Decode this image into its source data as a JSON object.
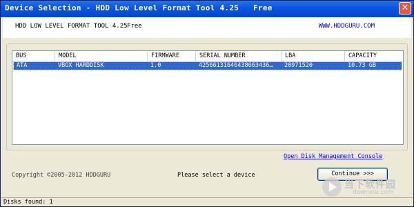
{
  "window": {
    "title": "Device Selection - HDD Low Level Format Tool 4.25   Free",
    "close_glyph": "✕"
  },
  "header": {
    "app_name": "HDD LOW LEVEL FORMAT TOOL 4.25",
    "edition": "Free",
    "website": "WWW.HDDGURU.COM"
  },
  "devices": {
    "columns": [
      "BUS",
      "MODEL",
      "FIRMWARE",
      "SERIAL NUMBER",
      "LBA",
      "CAPACITY"
    ],
    "rows": [
      {
        "bus": "ATA",
        "model": "VBOX HARDDISK",
        "firmware": "1.0",
        "serial": "42566131646438663436…",
        "lba": "20971520",
        "capacity": "10.73 GB",
        "selected": true
      }
    ]
  },
  "links": {
    "disk_management": "Open Disk Management Console"
  },
  "footer": {
    "copyright": "Copyright ©2005-2012 HDDGURU",
    "message": "Please select a device",
    "continue_label": "Continue >>>"
  },
  "statusbar": {
    "text": "Disks found: 1"
  },
  "watermark": {
    "cn_text": "当下软件园",
    "en_text": "downxia.com"
  },
  "colors": {
    "titlebar": "#0a55e1",
    "selection": "#316ac5",
    "link": "#0000ff",
    "dialog_bg": "#ece9d8"
  }
}
